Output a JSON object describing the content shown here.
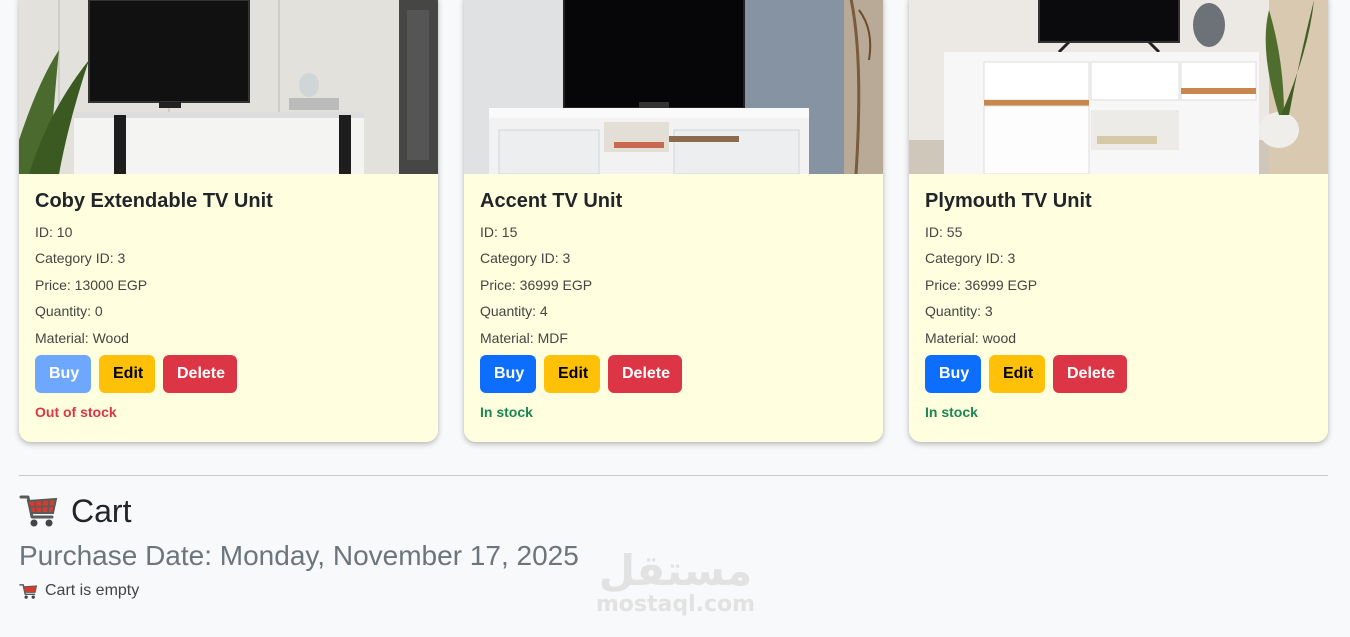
{
  "products": [
    {
      "name": "Coby Extendable TV Unit",
      "id": "ID: 10",
      "category": "Category ID: 3",
      "price": "Price: 13000 EGP",
      "quantity": "Quantity: 0",
      "material": "Material: Wood",
      "buy_label": "Buy",
      "edit_label": "Edit",
      "delete_label": "Delete",
      "status": "Out of stock"
    },
    {
      "name": "Accent TV Unit",
      "id": "ID: 15",
      "category": "Category ID: 3",
      "price": "Price: 36999 EGP",
      "quantity": "Quantity: 4",
      "material": "Material: MDF",
      "buy_label": "Buy",
      "edit_label": "Edit",
      "delete_label": "Delete",
      "status": "In stock"
    },
    {
      "name": "Plymouth TV Unit",
      "id": "ID: 55",
      "category": "Category ID: 3",
      "price": "Price: 36999 EGP",
      "quantity": "Quantity: 3",
      "material": "Material: wood",
      "buy_label": "Buy",
      "edit_label": "Edit",
      "delete_label": "Delete",
      "status": "In stock"
    }
  ],
  "cart": {
    "title": "Cart",
    "icon": "shopping-cart-icon",
    "purchase_date": "Purchase Date: Monday, November 17, 2025",
    "empty_text": "Cart is empty"
  },
  "watermark": {
    "arabic": "مستقل",
    "latin": "mostaql.com"
  },
  "colors": {
    "card_bg": "#ffffdf",
    "buy": "#0d6efd",
    "edit": "#ffc107",
    "delete": "#dc3545",
    "in_stock": "#198754",
    "out_of_stock": "#dc3545"
  }
}
